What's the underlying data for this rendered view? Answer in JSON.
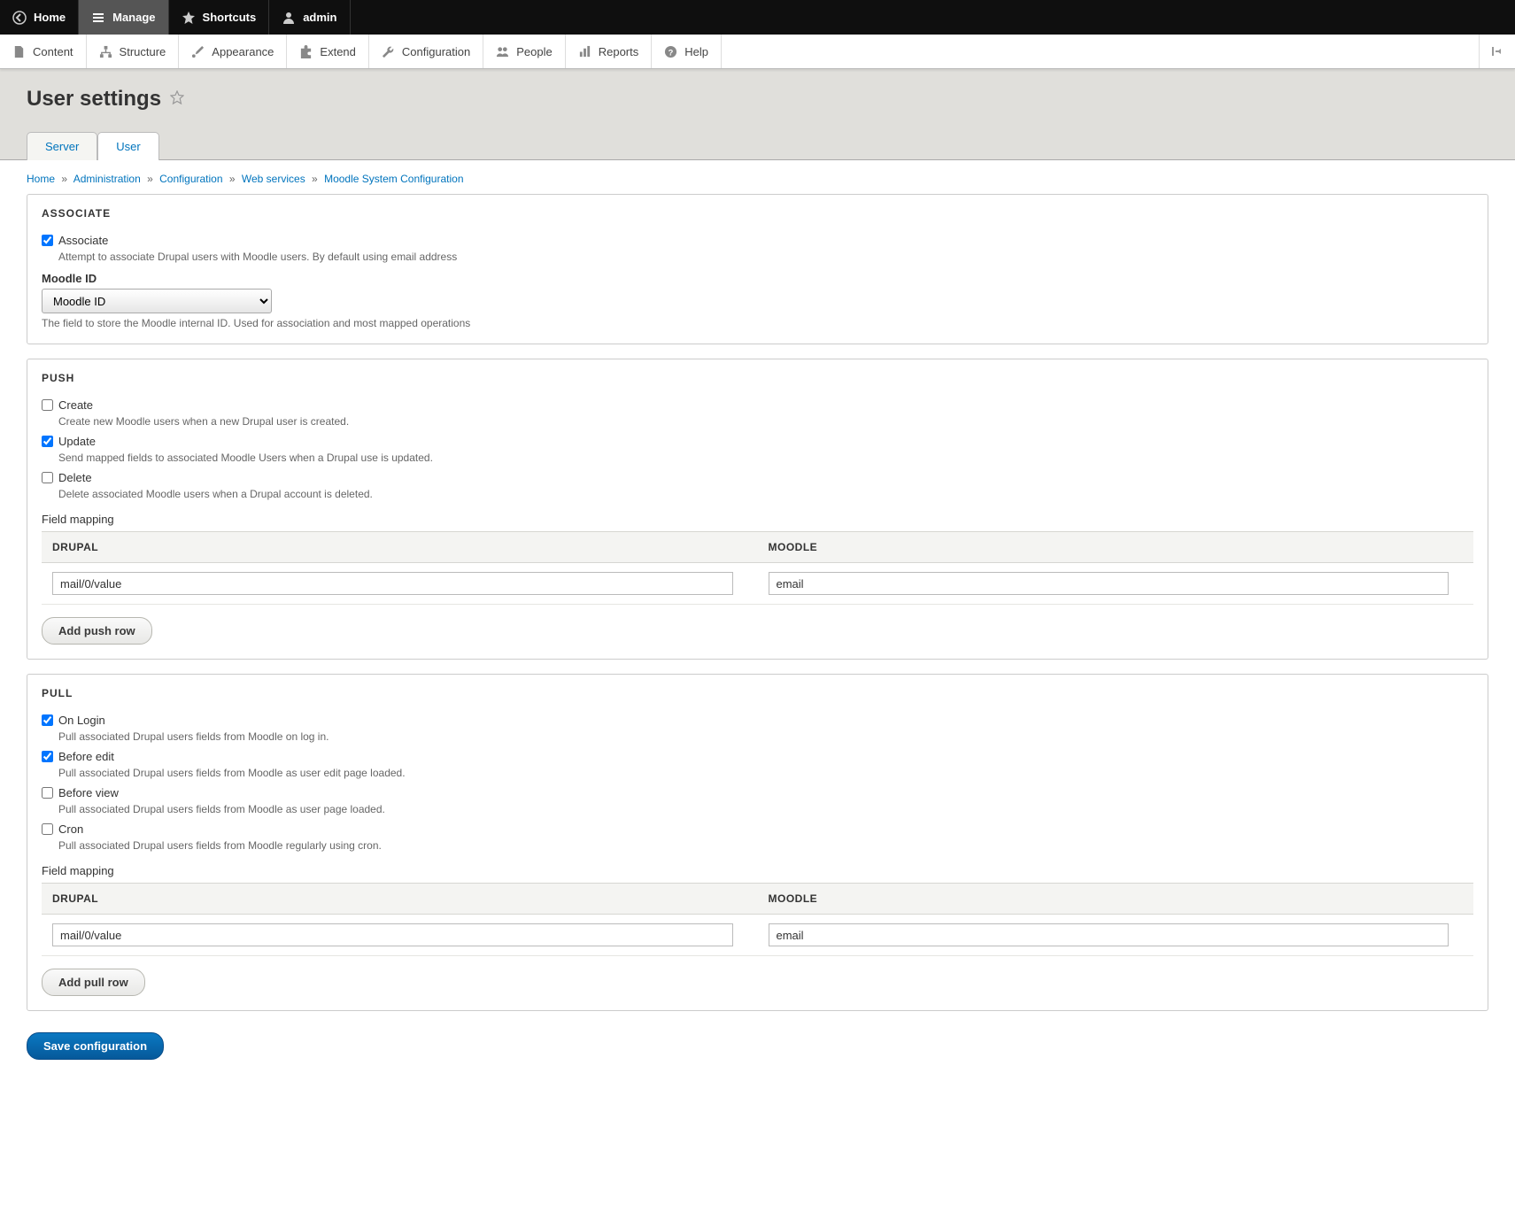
{
  "toolbar": {
    "home": "Home",
    "manage": "Manage",
    "shortcuts": "Shortcuts",
    "user": "admin"
  },
  "admin_menu": {
    "content": "Content",
    "structure": "Structure",
    "appearance": "Appearance",
    "extend": "Extend",
    "configuration": "Configuration",
    "people": "People",
    "reports": "Reports",
    "help": "Help"
  },
  "page": {
    "title": "User settings"
  },
  "tabs": {
    "server": "Server",
    "user": "User"
  },
  "breadcrumb": {
    "home": "Home",
    "admin": "Administration",
    "config": "Configuration",
    "ws": "Web services",
    "msc": "Moodle System Configuration"
  },
  "associate": {
    "legend": "ASSOCIATE",
    "cb_label": "Associate",
    "cb_desc": "Attempt to associate Drupal users with Moodle users. By default using email address",
    "field_label": "Moodle ID",
    "select_value": "Moodle ID",
    "hint": "The field to store the Moodle internal ID. Used for association and most mapped operations"
  },
  "push": {
    "legend": "PUSH",
    "create_label": "Create",
    "create_desc": "Create new Moodle users when a new Drupal user is created.",
    "update_label": "Update",
    "update_desc": "Send mapped fields to associated Moodle Users when a Drupal use is updated.",
    "delete_label": "Delete",
    "delete_desc": "Delete associated Moodle users when a Drupal account is deleted.",
    "mapping_label": "Field mapping",
    "col_drupal": "DRUPAL",
    "col_moodle": "MOODLE",
    "row_drupal": "mail/0/value",
    "row_moodle": "email",
    "add_btn": "Add push row"
  },
  "pull": {
    "legend": "PULL",
    "login_label": "On Login",
    "login_desc": "Pull associated Drupal users fields from Moodle on log in.",
    "before_edit_label": "Before edit",
    "before_edit_desc": "Pull associated Drupal users fields from Moodle as user edit page loaded.",
    "before_view_label": "Before view",
    "before_view_desc": "Pull associated Drupal users fields from Moodle as user page loaded.",
    "cron_label": "Cron",
    "cron_desc": "Pull associated Drupal users fields from Moodle regularly using cron.",
    "mapping_label": "Field mapping",
    "col_drupal": "DRUPAL",
    "col_moodle": "MOODLE",
    "row_drupal": "mail/0/value",
    "row_moodle": "email",
    "add_btn": "Add pull row"
  },
  "save_btn": "Save configuration"
}
